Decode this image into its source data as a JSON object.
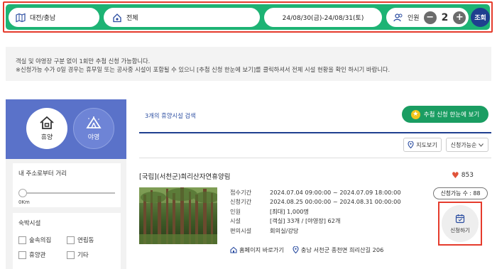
{
  "search": {
    "region": "대전/충남",
    "category": "전체",
    "date_range": "24/08/30(금)-24/08/31(토)",
    "people_label": "인원",
    "people_count": "2",
    "minus": "−",
    "plus": "+",
    "search_button": "조회"
  },
  "notice": {
    "line1": "객실 및 야영장 구분 없이 1회만 추첨 신청 가능합니다.",
    "line2": "※신청가능 수가 0일 경우는 휴무일 또는 공사중 시설이 포함될 수 있으니 [추첨 신청 한눈에 보기]를 클릭하셔서 전체 시설 현황을 확인 하시기 바랍니다."
  },
  "sidebar": {
    "categories": [
      {
        "label": "휴양",
        "active": true
      },
      {
        "label": "야영",
        "active": false
      }
    ],
    "distance": {
      "title": "내 주소로부터 거리",
      "value": "0Km",
      "level": 0
    },
    "lodging": {
      "title": "숙박시설",
      "options": [
        {
          "label": "숲속의집",
          "checked": false
        },
        {
          "label": "연립동",
          "checked": false
        },
        {
          "label": "휴양관",
          "checked": false
        },
        {
          "label": "기타",
          "checked": false
        }
      ]
    }
  },
  "main": {
    "result_count": "3개의 휴양시설 검색",
    "lottery_button": "추첨 신청 한눈에 보기",
    "map_button": "지도보기",
    "sort_label": "신청가능순",
    "facility": {
      "title": "[국립](서천군)희리산자연휴양림",
      "likes": "853",
      "rows": [
        {
          "key": "접수기간",
          "value": "2024.07.04 09:00:00 ~ 2024.07.09 18:00:00"
        },
        {
          "key": "신청기간",
          "value": "2024.08.25 00:00:00 ~ 2024.08.31 00:00:00"
        },
        {
          "key": "인원",
          "value": "[최대] 1,000명"
        },
        {
          "key": "시설",
          "value": "[객실] 33개 / [야영장] 62개"
        },
        {
          "key": "편의시설",
          "value": "회의실/강당"
        }
      ],
      "available": "신청가능 수 : 88",
      "apply_button": "신청하기",
      "homepage_link": "홈페이지 바로가기",
      "address": "충남 서천군 종천면 희리산길 206"
    }
  },
  "colors": {
    "bar_green": "#1db374",
    "navy": "#1f3f8f",
    "sidebar_blue": "#5a72c9",
    "highlight_red": "#e53b2c",
    "lottery_green": "#1a9d62"
  }
}
